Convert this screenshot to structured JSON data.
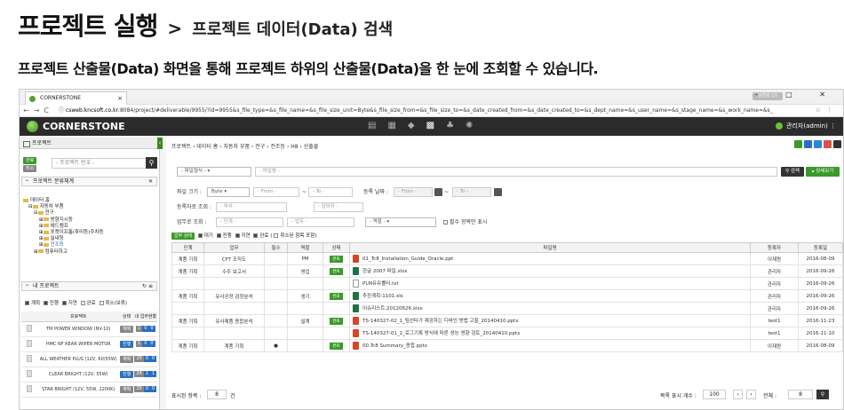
{
  "header": {
    "title": "프로젝트 실행",
    "arrow": ">",
    "subtitle": "프로젝트 데이터(Data) 검색"
  },
  "description": "프로젝트 산출물(Data) 화면을 통해 프로젝트 하위의 산출물(Data)을 한 눈에 조회할 수 있습니다.",
  "browser": {
    "tab_title": "CORNERSTONE",
    "url_host": "csweb.kncsoft.co.kr",
    "url_rest": ":8084/project/#deliverable/9955/?id=9955&s_file_type=&s_file_name=&s_file_size_unit=Byte&s_file_size_from=&s_file_size_to=&s_date_created_from=&s_date_created_to=&s_dept_name=&s_user_name=&s_stage_name=&s_work_name=&s_",
    "user_box": "김연희 (2)",
    "window_controls": "– □ ✕"
  },
  "app": {
    "logo": "CORNERSTONE",
    "admin": "관리자(admin)"
  },
  "left_panel": {
    "title": "프로젝트",
    "badges": [
      "완료",
      "취소"
    ],
    "search_placeholder": "- 프로젝트 번호 -",
    "tree_section": "프로젝트 분류체계",
    "tree": [
      {
        "label": "데이터 홈",
        "indent": 0
      },
      {
        "label": "자동차 부품",
        "indent": 1
      },
      {
        "label": "전구",
        "indent": 2
      },
      {
        "label": "방향지시등",
        "indent": 3
      },
      {
        "label": "헤드램프",
        "indent": 3
      },
      {
        "label": "포켓이프톱(후미등)주차등",
        "indent": 3
      },
      {
        "label": "실내등",
        "indent": 3
      },
      {
        "label": "전조등",
        "indent": 3
      },
      {
        "label": "컴퓨터하고",
        "indent": 2
      }
    ],
    "my_projects_section": "내 프로젝트",
    "filters": [
      "계획",
      "진행",
      "지연",
      "완료",
      "취소(보류)"
    ],
    "table_headers": [
      "프로젝트",
      "상태",
      "내 업무현황"
    ],
    "projects": [
      {
        "name": "TM POWER WINDOW (NV-10)",
        "state": "계획",
        "counts": [
          "1",
          "0",
          "0"
        ]
      },
      {
        "name": "HMC NF REAR WIPER MOTOR",
        "state": "진행",
        "counts": [
          "1",
          "0",
          "0"
        ]
      },
      {
        "name": "ALL WEATHER PLUS (12V, 60/55W)",
        "state": "계획",
        "counts": [
          "25",
          "0",
          "0"
        ]
      },
      {
        "name": "CLEAR BRIGHT (12V, 55W)",
        "state": "진행",
        "counts": [
          "24",
          "1",
          "1"
        ]
      },
      {
        "name": "STAR BRIGHT (12V, 55W, 2200K)",
        "state": "계획",
        "counts": [
          "25",
          "0",
          "0"
        ]
      }
    ]
  },
  "main": {
    "breadcrumb": "프로젝트 › 데이터 홈 › 자동차 부품 › 전구 › 전조등 › H8 › 산출물",
    "file_type_placeholder": "- 파일형식 -",
    "file_name_placeholder": "- 파일명 -",
    "search_button": "검색",
    "detail_button": "상세보기",
    "file_size_label": "파일 크기 :",
    "size_unit": "Byte",
    "from_placeholder": "- From -",
    "to_placeholder": "- To -",
    "reg_date_label": "등록 날짜 :",
    "dept_label": "등록자로 조회 :",
    "dept_placeholder": "- 부서 -",
    "user_placeholder": "- 담당자 -",
    "work_label": "업무로 조회 :",
    "stage_placeholder": "- 단계 -",
    "work_placeholder": "- 업무 -",
    "role_placeholder": "- 역할 -",
    "required_only": "필수 항목만 표시",
    "status_bar": {
      "label": "업무 상태",
      "items": [
        "대기",
        "진행",
        "지연",
        "완료",
        "취소된 항목 포함"
      ]
    },
    "columns": [
      "단계",
      "업무",
      "필수",
      "역할",
      "상태",
      "파일명",
      "등록자",
      "등록일"
    ],
    "rows": [
      {
        "stage": "계품 기획",
        "work": "CFT 조직도",
        "req": "",
        "role": "PM",
        "state": "완료",
        "file": "01_Tc8_Installation_Guide_Oracle.ppt",
        "ftype": "ppt",
        "user": "이재원",
        "date": "2016-08-09"
      },
      {
        "stage": "계품 기획",
        "work": "수주 보고서",
        "req": "",
        "role": "영업",
        "state": "완료",
        "file": "한글 2007 파일.xlsx",
        "ftype": "xls",
        "user": "관리자",
        "date": "2016-09-26"
      },
      {
        "stage": "",
        "work": "",
        "req": "",
        "role": "",
        "state": "",
        "file": "PLM유유률터.txt",
        "ftype": "txt",
        "user": "관리자",
        "date": "2016-09-26"
      },
      {
        "stage": "계품 기획",
        "work": "유사공정 검정분석",
        "req": "",
        "role": "생기",
        "state": "완료",
        "file": "추진계획-1101.xls",
        "ftype": "xls",
        "user": "관리자",
        "date": "2016-09-26"
      },
      {
        "stage": "",
        "work": "",
        "req": "",
        "role": "",
        "state": "",
        "file": "이슈리스트.20120626.xlsx",
        "ftype": "xls",
        "user": "관리자",
        "date": "2016-09-26"
      },
      {
        "stage": "계품 기획",
        "work": "유사제품 종합분석",
        "req": "",
        "role": "설계",
        "state": "완료",
        "file": "TS-140327-02_1_팀선타가 제공하는 디바인 방법 고찰_20140410.pptx",
        "ftype": "ppt",
        "user": "test1",
        "date": "2016-11-23"
      },
      {
        "stage": "",
        "work": "",
        "req": "",
        "role": "",
        "state": "",
        "file": "TS-140327-01_1_로그기록 방식에 따른 성능 영향 검토_20140410.pptx",
        "ftype": "ppt",
        "user": "test1",
        "date": "2016-11-10"
      },
      {
        "stage": "계품 기획",
        "work": "계품 기획",
        "req": "●",
        "role": "",
        "state": "완료",
        "file": "00.Tc8 Summary_종합.pptx",
        "ftype": "ppt",
        "user": "이재원",
        "date": "2016-08-09"
      }
    ],
    "pager": {
      "rows_label": "표시된 항목 :",
      "rows_value": "8",
      "rows_unit": "건",
      "per_page_label": "목록 표시 개수 :",
      "per_page": "100",
      "total_label": "전체 :",
      "total": "8"
    }
  },
  "colors": {
    "accent": "#3a9a2a",
    "appbar": "#2b2b2b"
  }
}
